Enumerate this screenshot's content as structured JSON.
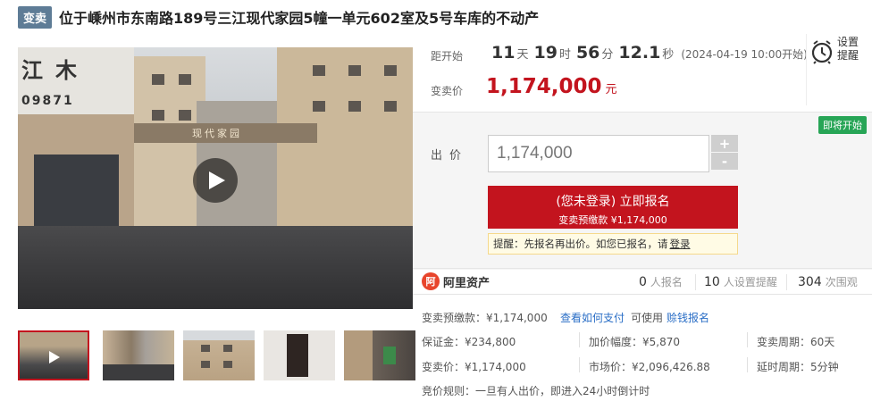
{
  "header": {
    "tag": "变卖",
    "title": "位于嵊州市东南路189号三江现代家园5幢一单元602室及5号车库的不动产"
  },
  "media": {
    "sign_text": "江木",
    "sign_number": "09871",
    "gate_text": "现代家园",
    "play_icon": "play-icon",
    "thumbnails": [
      {
        "name": "thumb-1",
        "active": true
      },
      {
        "name": "thumb-2",
        "active": false
      },
      {
        "name": "thumb-3",
        "active": false
      },
      {
        "name": "thumb-4",
        "active": false
      },
      {
        "name": "thumb-5",
        "active": false
      }
    ]
  },
  "countdown": {
    "label": "距开始",
    "days": "11",
    "days_unit": "天",
    "hours": "19",
    "hours_unit": "时",
    "minutes": "56",
    "minutes_unit": "分",
    "seconds": "12.1",
    "seconds_unit": "秒",
    "start_note": "(2024-04-19 10:00开始)"
  },
  "price": {
    "label": "变卖价",
    "value": "1,174,000",
    "unit": "元"
  },
  "remind": {
    "line1": "设置",
    "line2": "提醒",
    "icon": "alarm-clock-icon"
  },
  "bid": {
    "badge": "即将开始",
    "label": "出价",
    "value": "1,174,000",
    "plus": "+",
    "minus": "-",
    "signup_line1": "(您未登录) 立即报名",
    "signup_line2": "变卖预缴款 ¥1,174,000",
    "tip_text": "提醒：先报名再出价。如您已报名，请",
    "tip_link": "登录"
  },
  "stats": {
    "brand_name": "阿里资产",
    "signed_count": "0",
    "signed_label": "人报名",
    "reminder_count": "10",
    "reminder_label": "人设置提醒",
    "views_count": "304",
    "views_label": "次围观"
  },
  "details": {
    "deposit_label": "变卖预缴款：¥1,174,000",
    "how_to_pay": "查看如何支付",
    "usable_prefix": "可使用",
    "insurance_link": "赊钱报名",
    "guarantee": "保证金：¥234,800",
    "increment": "加价幅度：¥5,870",
    "period": "变卖周期：60天",
    "sale_price": "变卖价：¥1,174,000",
    "market_price": "市场价：¥2,096,426.88",
    "delay_period": "延时周期：5分钟",
    "bid_rule": "竞价规则：一旦有人出价，即进入24小时倒计时"
  },
  "colors": {
    "accent": "#c3141e",
    "tag_bg": "#5e7c96",
    "badge_green": "#27a556",
    "link": "#2a6ec6"
  }
}
